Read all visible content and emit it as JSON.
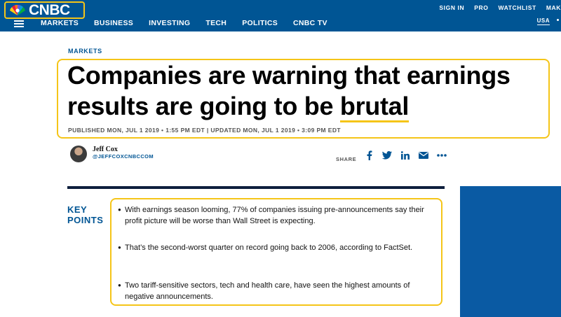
{
  "colors": {
    "brand_blue": "#005594",
    "highlight_yellow": "#f5c518",
    "rail_blue": "#0a5aa3",
    "rule_navy": "#0e1f3d"
  },
  "header": {
    "logo_icon": "peacock-icon",
    "logo_text": "CNBC",
    "top_links": [
      "SIGN IN",
      "PRO",
      "WATCHLIST",
      "MAK"
    ],
    "menu_icon": "hamburger-menu-icon",
    "nav": [
      "MARKETS",
      "BUSINESS",
      "INVESTING",
      "TECH",
      "POLITICS",
      "CNBC TV"
    ],
    "region": "USA"
  },
  "article": {
    "section": "MARKETS",
    "headline_part1": "Companies are warning that earnings results are going to be ",
    "headline_highlight": "brutal",
    "timestamp": "PUBLISHED MON, JUL 1 2019 • 1:55 PM EDT | UPDATED MON, JUL 1 2019 • 3:09 PM EDT",
    "author": "Jeff Cox",
    "handle": "@JEFFCOXCNBCCOM",
    "share_label": "SHARE",
    "share_icons": [
      "facebook-icon",
      "twitter-icon",
      "linkedin-icon",
      "email-icon",
      "more-icon"
    ]
  },
  "key_points": {
    "title_line1": "KEY",
    "title_line2": "POINTS",
    "items": [
      "With earnings season looming, 77% of companies issuing pre-announcements say their profit picture will be worse than Wall Street is expecting.",
      "That’s the second-worst quarter on record going back to 2006, according to FactSet.",
      "Two tariff-sensitive sectors, tech and health care, have seen the highest amounts of negative announcements."
    ]
  }
}
